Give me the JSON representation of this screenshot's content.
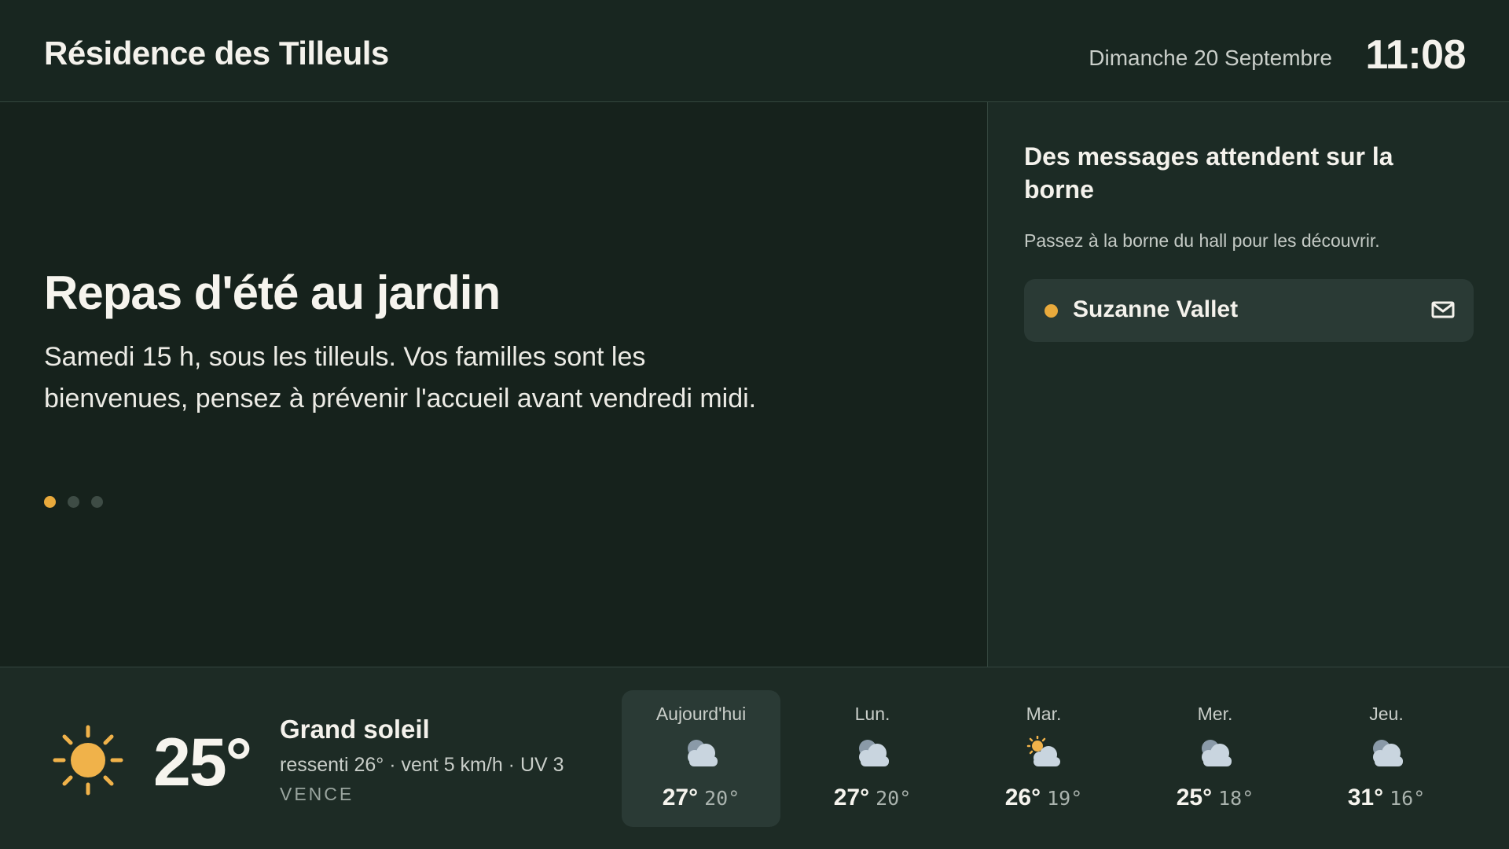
{
  "header": {
    "residence": "Résidence des Tilleuls",
    "date": "Dimanche 20 Septembre",
    "time": "11:08"
  },
  "announcement": {
    "title": "Repas d'été au jardin",
    "body": "Samedi 15 h, sous les tilleuls. Vos familles sont les bienvenues, pensez à prévenir l'accueil avant vendredi midi.",
    "slide_count": 3,
    "active_slide": 1
  },
  "messages": {
    "title": "Des messages attendent sur la borne",
    "subtitle": "Passez à la borne du hall pour les découvrir.",
    "items": [
      {
        "name": "Suzanne Vallet",
        "icon": "mail-icon"
      }
    ]
  },
  "weather": {
    "current": {
      "icon": "sun-icon",
      "temp": "25°",
      "condition": "Grand soleil",
      "details": "ressenti 26° · vent 5 km/h · UV 3",
      "city": "VENCE"
    },
    "forecast": [
      {
        "day": "Aujourd'hui",
        "icon": "cloud-icon",
        "high": "27°",
        "low": "20°"
      },
      {
        "day": "Lun.",
        "icon": "cloud-icon",
        "high": "27°",
        "low": "20°"
      },
      {
        "day": "Mar.",
        "icon": "sun-cloud-icon",
        "high": "26°",
        "low": "19°"
      },
      {
        "day": "Mer.",
        "icon": "cloud-icon",
        "high": "25°",
        "low": "18°"
      },
      {
        "day": "Jeu.",
        "icon": "cloud-icon",
        "high": "31°",
        "low": "16°"
      }
    ]
  },
  "colors": {
    "accent": "#e9aa3c",
    "background": "#16221c",
    "panel": "#1c2b25"
  }
}
